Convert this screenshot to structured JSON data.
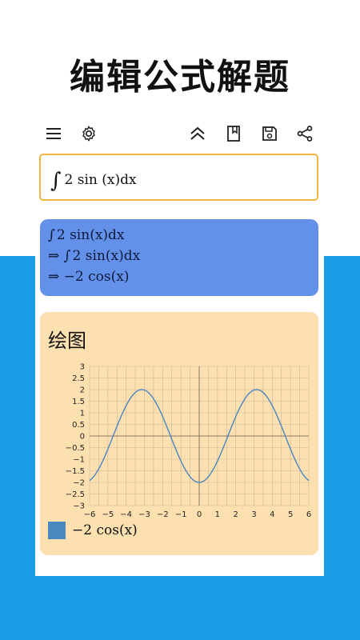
{
  "headline": "编辑公式解题",
  "toolbar": {
    "menu_icon": "menu-icon",
    "settings_icon": "gear-icon",
    "collapse_icon": "double-chevron-up-icon",
    "bookmark_icon": "bookmark-icon",
    "save_icon": "save-icon",
    "share_icon": "share-icon"
  },
  "input": {
    "expression": "2 sin (x)dx"
  },
  "steps": [
    {
      "prefix": "",
      "body": "2 sin(x)dx",
      "integral": true
    },
    {
      "prefix": "⇒",
      "body": "2 sin(x)dx",
      "integral": true
    },
    {
      "prefix": "⇒",
      "body": "−2 cos(x)",
      "integral": false
    }
  ],
  "plot": {
    "title": "绘图",
    "legend_label": "−2 cos(x)",
    "series_color": "#4a86c0"
  },
  "colors": {
    "accent_border": "#f3b53d",
    "steps_bg": "#6390e8",
    "plot_bg": "#fde0b0",
    "band": "#1a9be6"
  },
  "chart_data": {
    "type": "line",
    "function": "-2*cos(x)",
    "xlim": [
      -6,
      6
    ],
    "ylim": [
      -3,
      3
    ],
    "x_ticks": [
      "−6",
      "−5",
      "−4",
      "−3",
      "−2",
      "−1",
      "0",
      "1",
      "2",
      "3",
      "4",
      "5",
      "6"
    ],
    "y_ticks": [
      "3",
      "2.5",
      "2",
      "1.5",
      "1",
      "0.5",
      "0",
      "−0.5",
      "−1",
      "−1.5",
      "−2",
      "−2.5",
      "−3"
    ],
    "grid": true,
    "series": [
      {
        "name": "−2 cos(x)"
      }
    ]
  }
}
